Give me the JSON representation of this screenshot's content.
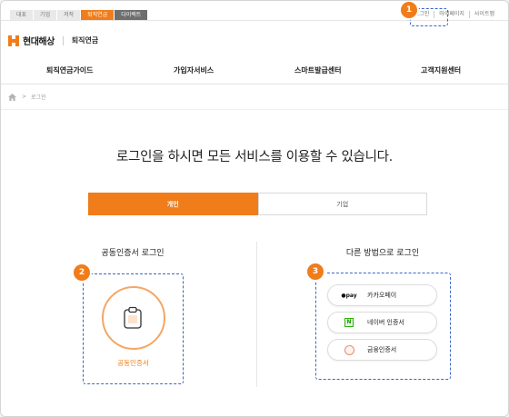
{
  "topbar": {
    "segments": [
      "대표",
      "기업",
      "저작",
      "퇴직연금",
      "다이렉트"
    ],
    "links": [
      "로그인",
      "마이페이지",
      "사이트맵"
    ]
  },
  "header": {
    "brand": "현대해상",
    "service": "퇴직연금"
  },
  "gnb": [
    "퇴직연금가이드",
    "가입자서비스",
    "스마트발급센터",
    "고객지원센터"
  ],
  "breadcrumb": {
    "current": "로그인"
  },
  "main": {
    "headline": "로그인을 하시면 모든 서비스를 이용할 수 있습니다.",
    "tabs": [
      "개인",
      "기업"
    ],
    "left": {
      "title": "공동인증서 로그인",
      "badge": "2",
      "cert_label": "공동인증서"
    },
    "right": {
      "title": "다른 방법으로 로그인",
      "badge": "3",
      "pay_logo": "●pay",
      "naver_logo": "N",
      "options": [
        "카카오페이",
        "네이버 인증서",
        "금융인증서"
      ]
    },
    "top_badge": "1"
  },
  "colors": {
    "accent": "#f07d1a",
    "annotation": "#3a66c8"
  }
}
